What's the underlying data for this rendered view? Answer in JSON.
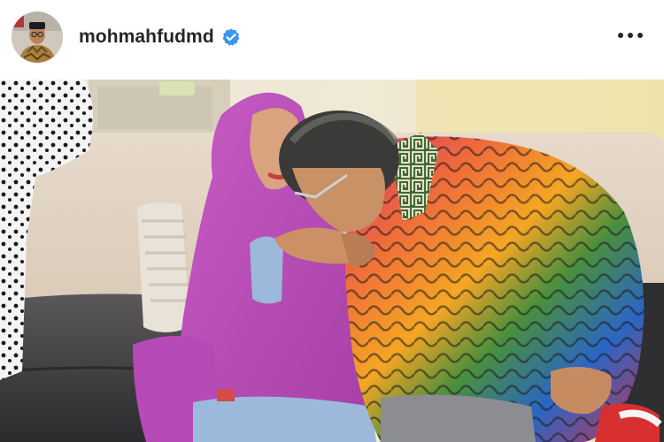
{
  "post": {
    "username": "mohmahfudmd",
    "verified": true,
    "icons": {
      "avatar": "profile-avatar",
      "verified": "verified-badge-icon",
      "more": "more-options-icon"
    },
    "photo": {
      "subject": "photo"
    }
  },
  "colors": {
    "verified_blue": "#3897f0",
    "username_text": "#262626",
    "header_bg": "#ffffff"
  }
}
